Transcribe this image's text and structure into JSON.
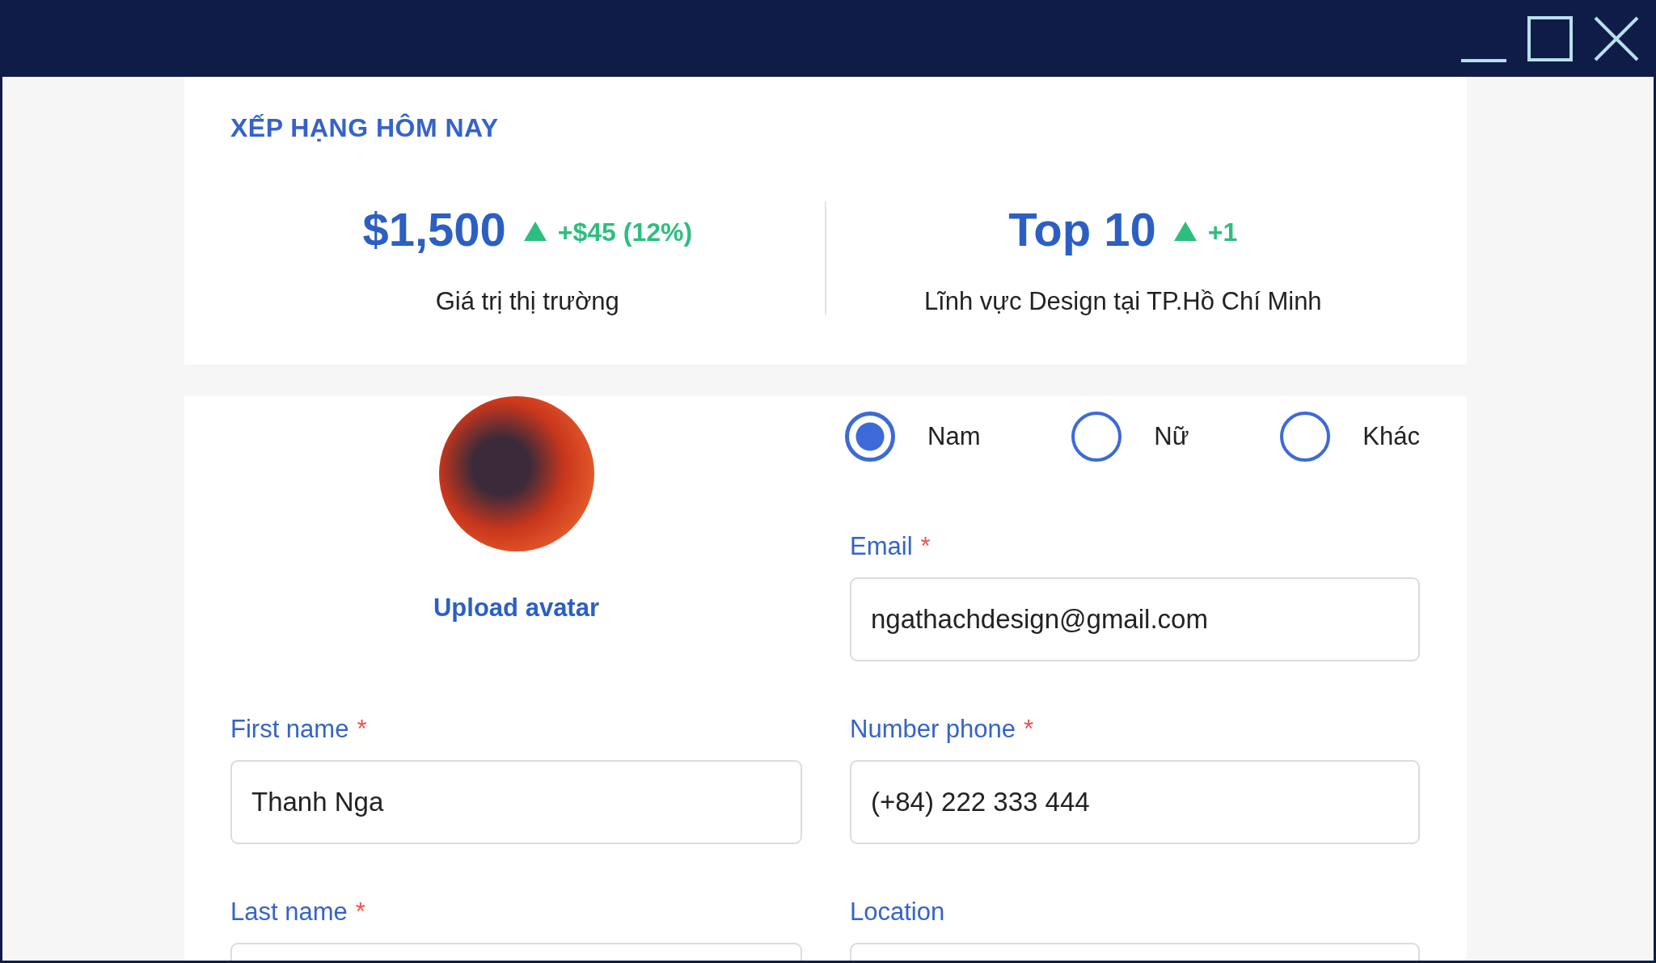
{
  "ranking": {
    "title": "XẾP HẠNG HÔM NAY",
    "stats": [
      {
        "value": "$1,500",
        "change": "+$45 (12%)",
        "caption": "Giá trị thị trường"
      },
      {
        "value": "Top 10",
        "change": "+1",
        "caption": "Lĩnh vực Design tại TP.Hồ Chí Minh"
      }
    ]
  },
  "profile": {
    "upload_label": "Upload avatar",
    "gender_options": [
      {
        "label": "Nam",
        "selected": true
      },
      {
        "label": "Nữ",
        "selected": false
      },
      {
        "label": "Khác",
        "selected": false
      }
    ],
    "fields": [
      {
        "label": "Email",
        "required_mark": "*",
        "value": "ngathachdesign@gmail.com"
      },
      {
        "label": "First name",
        "required_mark": "*",
        "value": "Thanh Nga"
      },
      {
        "label": "Number phone",
        "required_mark": "*",
        "value": "(+84) 222 333 444"
      },
      {
        "label": "Last name",
        "required_mark": "*"
      },
      {
        "label": "Location"
      }
    ]
  }
}
